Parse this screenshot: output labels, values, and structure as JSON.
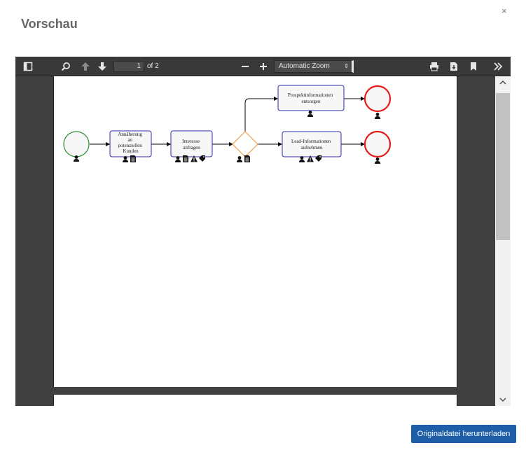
{
  "dialog": {
    "title": "Vorschau",
    "close_symbol": "×",
    "download_label": "Originaldatei herunterladen"
  },
  "toolbar": {
    "page_number": "1",
    "page_of": "of 2",
    "zoom_label": "Automatic Zoom",
    "zoom_arrow": "⇕"
  },
  "diagram": {
    "tasks": [
      {
        "lines": [
          "Annäherung",
          "an",
          "potenziellen",
          "Kunden"
        ]
      },
      {
        "lines": [
          "Interesse",
          "anfragen"
        ]
      },
      {
        "lines": [
          "Prospektinformationen",
          "entsorgen"
        ]
      },
      {
        "lines": [
          "Lead-Informationen",
          "aufnehmen"
        ]
      }
    ],
    "colors": {
      "start_event": "#2e8b2e",
      "end_event": "#e31b1b",
      "gateway": "#f0a040",
      "task_border": "#2b2bb0",
      "task_fill": "#f7f7f7"
    }
  }
}
